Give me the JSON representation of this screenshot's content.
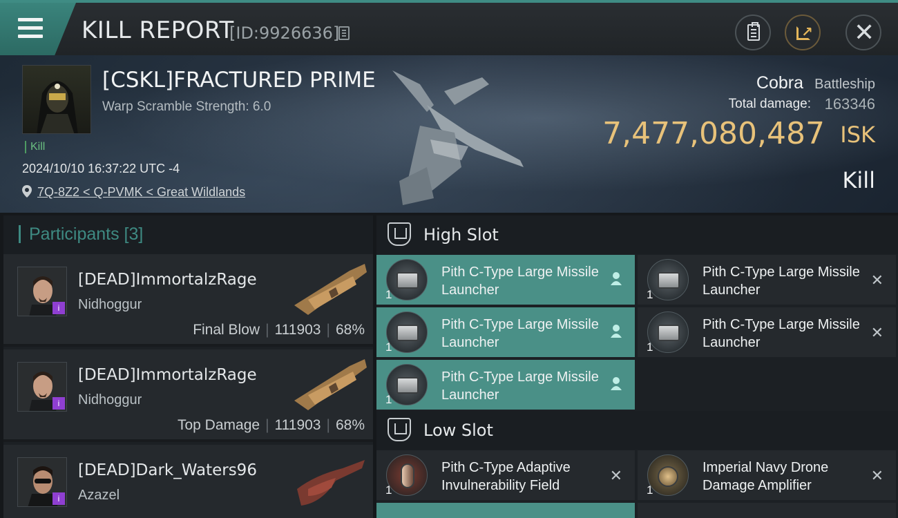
{
  "header": {
    "title": "KILL REPORT",
    "report_id": "[ID:9926636]"
  },
  "victim": {
    "name": "[CSKL]FRACTURED PRIME",
    "warp_scramble": "Warp Scramble Strength: 6.0",
    "tag": "Kill",
    "datetime": "2024/10/10 16:37:22 UTC -4",
    "location": "7Q-8Z2 < Q-PVMK < Great Wildlands"
  },
  "ship": {
    "name": "Cobra",
    "class": "Battleship",
    "total_damage_label": "Total damage:",
    "total_damage": "163346",
    "isk_value": "7,477,080,487",
    "isk_unit": "ISK",
    "result": "Kill"
  },
  "participants": {
    "title": "Participants [3]",
    "rows": [
      {
        "name": "[DEAD]ImmortalzRage",
        "ship": "Nidhoggur",
        "role": "Final Blow",
        "damage": "111903",
        "percent": "68%"
      },
      {
        "name": "[DEAD]ImmortalzRage",
        "ship": "Nidhoggur",
        "role": "Top Damage",
        "damage": "111903",
        "percent": "68%"
      },
      {
        "name": "[DEAD]Dark_Waters96",
        "ship": "Azazel"
      }
    ]
  },
  "slots": {
    "high": {
      "label": "High Slot",
      "modules": [
        {
          "name": "Pith C-Type Large Missile Launcher",
          "qty": "1",
          "state": "dropped"
        },
        {
          "name": "Pith C-Type Large Missile Launcher",
          "qty": "1",
          "state": "destroyed"
        },
        {
          "name": "Pith C-Type Large Missile Launcher",
          "qty": "1",
          "state": "dropped"
        },
        {
          "name": "Pith C-Type Large Missile Launcher",
          "qty": "1",
          "state": "destroyed"
        },
        {
          "name": "Pith C-Type Large Missile Launcher",
          "qty": "1",
          "state": "dropped"
        }
      ]
    },
    "low": {
      "label": "Low Slot",
      "modules": [
        {
          "name": "Pith C-Type Adaptive Invulnerability Field",
          "qty": "1",
          "state": "destroyed"
        },
        {
          "name": "Imperial Navy Drone Damage Amplifier",
          "qty": "1",
          "state": "destroyed"
        }
      ]
    }
  },
  "colors": {
    "accent": "#3e8a82",
    "isk": "#e8c27a",
    "dropped_bg": "#4a9087",
    "panel_bg": "#25292d"
  },
  "icons": {
    "menu": "hamburger-icon",
    "copy": "copy-icon",
    "clipboard": "clipboard-icon",
    "share": "share-icon",
    "close": "close-icon",
    "location": "location-pin-icon",
    "slot": "slot-icon",
    "dropped": "person-icon",
    "destroyed": "x-icon"
  }
}
